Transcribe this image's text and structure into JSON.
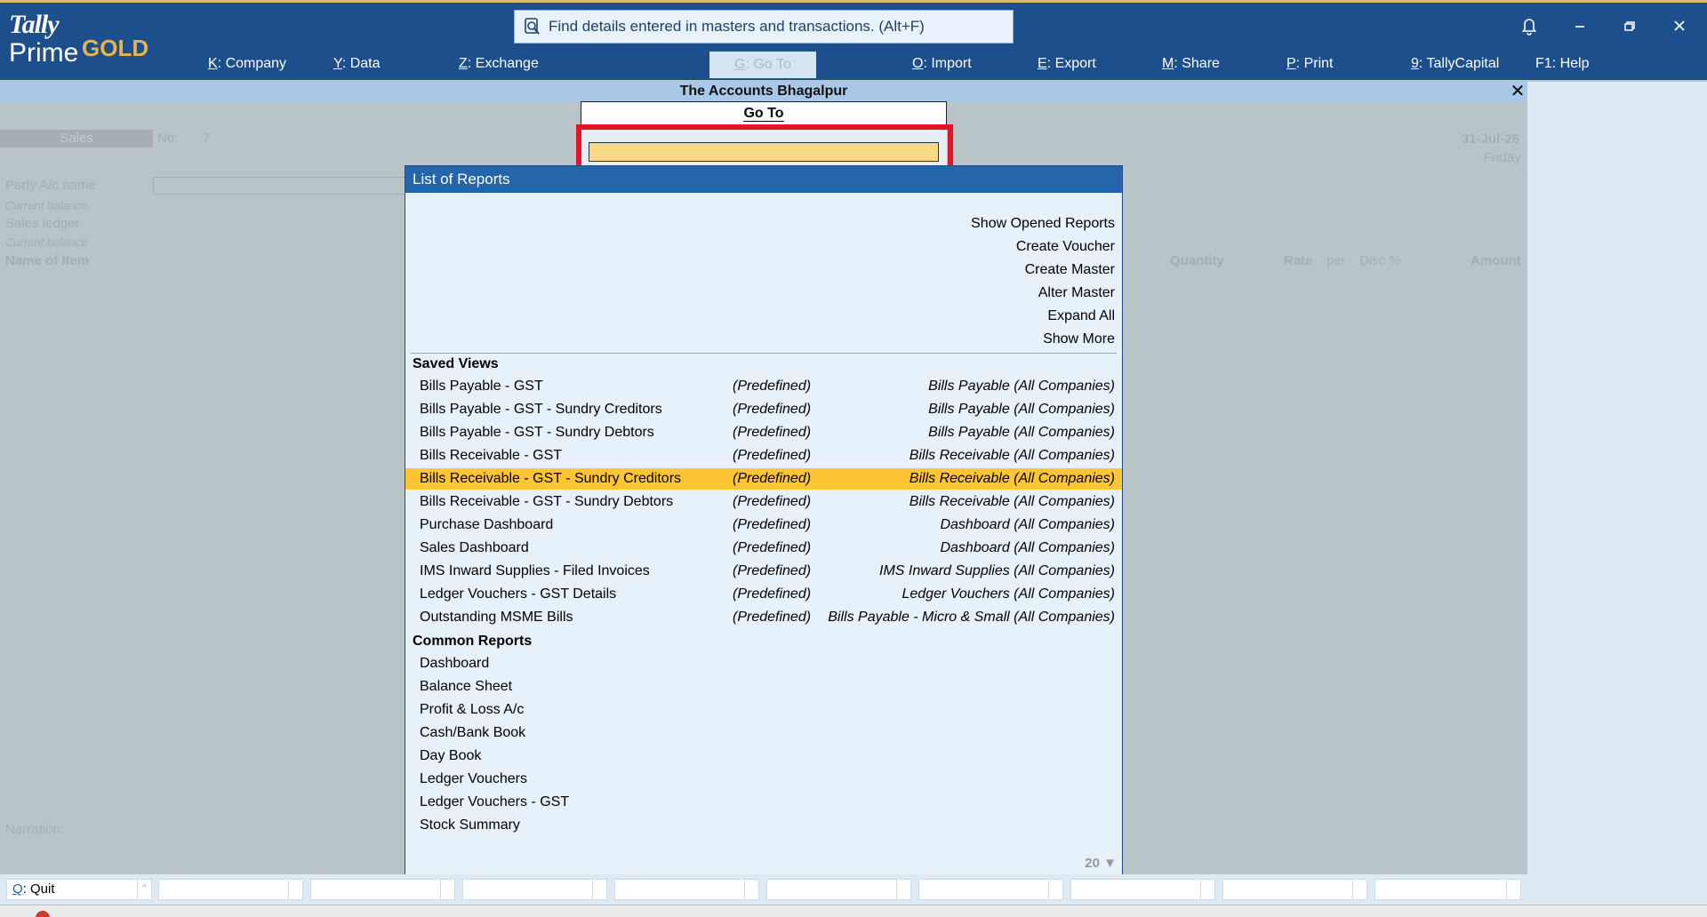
{
  "app": {
    "logo_tally": "Tally",
    "logo_prime": "Prime",
    "logo_gold": "GOLD",
    "search_placeholder": "Find details entered in masters and transactions. (Alt+F)"
  },
  "menu": [
    {
      "key": "K",
      "label": "Company"
    },
    {
      "key": "Y",
      "label": "Data"
    },
    {
      "key": "Z",
      "label": "Exchange"
    },
    {
      "key": "G",
      "label": "Go To"
    },
    {
      "key": "O",
      "label": "Import"
    },
    {
      "key": "E",
      "label": "Export"
    },
    {
      "key": "M",
      "label": "Share"
    },
    {
      "key": "P",
      "label": "Print"
    },
    {
      "key": "9",
      "label": "TallyCapital"
    },
    {
      "key": "F1",
      "label": "Help"
    }
  ],
  "company_name": "The Accounts Bhagalpur",
  "voucher": {
    "type": "Sales",
    "no_label": "No.",
    "no_value": "7",
    "date": "31-Jul-26",
    "day": "Friday",
    "party_label": "Party A/c name",
    "current_balance_1": "Current balance",
    "sales_ledger_label": "Sales ledger",
    "current_balance_2": "Current balance",
    "item_header": "Name of Item",
    "qty_header": "Quantity",
    "rate_header": "Rate",
    "per_header": "per",
    "disc_header": "Disc %",
    "amount_header": "Amount",
    "narration_label": "Narration:"
  },
  "goto": {
    "title": "Go To",
    "input_value": ""
  },
  "list": {
    "header": "List of Reports",
    "actions": [
      "Show Opened Reports",
      "Create Voucher",
      "Create Master",
      "Alter Master",
      "Expand All",
      "Show More"
    ],
    "saved_views_title": "Saved Views",
    "saved_views": [
      {
        "name": "Bills Payable - GST",
        "type": "(Predefined)",
        "report": "Bills Payable (All Companies)"
      },
      {
        "name": "Bills Payable - GST - Sundry Creditors",
        "type": "(Predefined)",
        "report": "Bills Payable (All Companies)"
      },
      {
        "name": "Bills Payable - GST - Sundry Debtors",
        "type": "(Predefined)",
        "report": "Bills Payable (All Companies)"
      },
      {
        "name": "Bills Receivable - GST",
        "type": "(Predefined)",
        "report": "Bills Receivable (All Companies)"
      },
      {
        "name": "Bills Receivable - GST - Sundry Creditors",
        "type": "(Predefined)",
        "report": "Bills Receivable (All Companies)"
      },
      {
        "name": "Bills Receivable - GST - Sundry Debtors",
        "type": "(Predefined)",
        "report": "Bills Receivable (All Companies)"
      },
      {
        "name": "Purchase Dashboard",
        "type": "(Predefined)",
        "report": "Dashboard (All Companies)"
      },
      {
        "name": "Sales Dashboard",
        "type": "(Predefined)",
        "report": "Dashboard (All Companies)"
      },
      {
        "name": "IMS Inward Supplies - Filed Invoices",
        "type": "(Predefined)",
        "report": "IMS Inward Supplies (All Companies)"
      },
      {
        "name": "Ledger Vouchers - GST Details",
        "type": "(Predefined)",
        "report": "Ledger Vouchers (All Companies)"
      },
      {
        "name": "Outstanding MSME Bills",
        "type": "(Predefined)",
        "report": "Bills Payable - Micro & Small (All Companies)"
      }
    ],
    "selected_index": 4,
    "common_reports_title": "Common Reports",
    "common_reports": [
      "Dashboard",
      "Balance Sheet",
      "Profit & Loss A/c",
      "Cash/Bank Book",
      "Day Book",
      "Ledger Vouchers",
      "Ledger Vouchers - GST",
      "Stock Summary"
    ],
    "more_count": "20 ▼"
  },
  "bottom": {
    "quit_key": "Q",
    "quit_label": "Quit"
  }
}
